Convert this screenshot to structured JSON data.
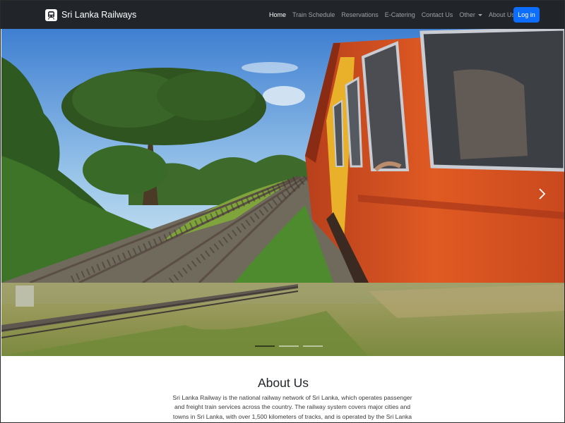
{
  "navbar": {
    "brand": "Sri Lanka Railways",
    "brand_icon": "train-icon",
    "links": [
      {
        "label": "Home",
        "active": true
      },
      {
        "label": "Train Schedule",
        "active": false
      },
      {
        "label": "Reservations",
        "active": false
      },
      {
        "label": "E-Catering",
        "active": false
      },
      {
        "label": "Contact Us",
        "active": false
      },
      {
        "label": "Other",
        "active": false,
        "dropdown": true
      },
      {
        "label": "About Us",
        "active": false,
        "dropdown": true
      }
    ],
    "login_label": "Log in",
    "colors": {
      "background": "#212529",
      "login": "#0d6efd"
    }
  },
  "carousel": {
    "next_icon": "chevron-right-icon",
    "slides_count": 3,
    "active_index": 0
  },
  "about": {
    "title": "About Us",
    "text": "Sri Lanka Railway is the national railway network of Sri Lanka, which operates passenger and freight train services across the country. The railway system covers major cities and towns in Sri Lanka, with over 1,500 kilometers of tracks, and is operated by the Sri Lanka"
  }
}
